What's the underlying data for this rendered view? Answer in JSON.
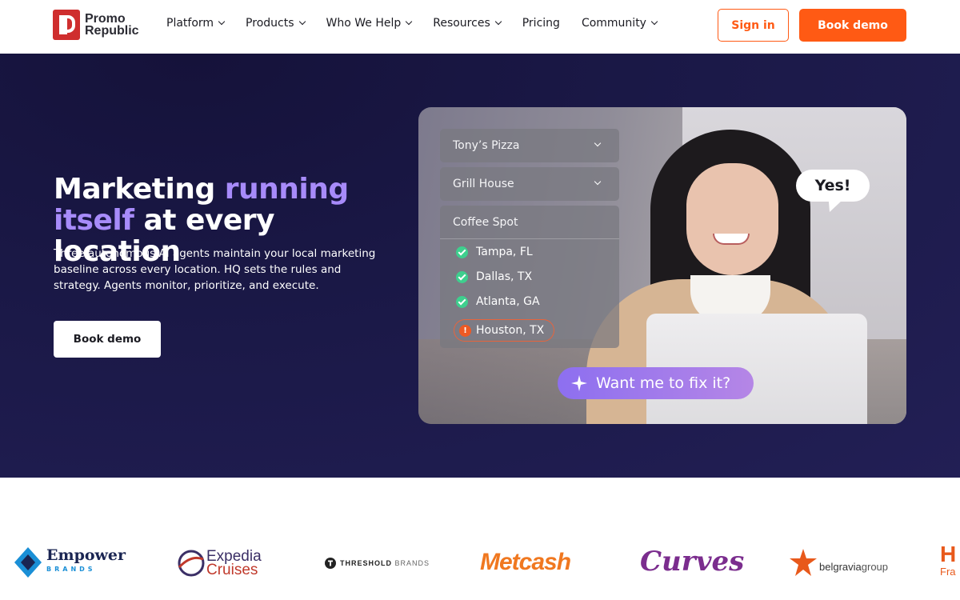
{
  "nav": {
    "logo": {
      "line1": "Promo",
      "line2": "Republic",
      "color": "#cf2e2e"
    },
    "menu": [
      {
        "label": "Platform",
        "dropdown": true
      },
      {
        "label": "Products",
        "dropdown": true
      },
      {
        "label": "Who We Help",
        "dropdown": true
      },
      {
        "label": "Resources",
        "dropdown": true
      },
      {
        "label": "Pricing",
        "dropdown": false
      },
      {
        "label": "Community",
        "dropdown": true
      }
    ],
    "sign_in": "Sign in",
    "book_demo": "Book demo",
    "accent_color": "#ff5a14"
  },
  "hero": {
    "title_part1": "Marketing ",
    "title_accent1": "running",
    "title_accent2": "itself",
    "title_part2": " at every location",
    "description": "Three autonomous AI agents maintain your local marketing baseline across every location. HQ sets the rules and strategy. Agents monitor, prioritize, and execute.",
    "cta": "Book demo",
    "bg_color": "#1a1846",
    "accent_color": "#a78bfa"
  },
  "card": {
    "dropdowns": [
      {
        "label": "Tony’s Pizza",
        "expanded": false
      },
      {
        "label": "Grill House",
        "expanded": false
      },
      {
        "label": "Coffee Spot",
        "expanded": true
      }
    ],
    "locations": [
      {
        "name": "Tampa, FL",
        "status": "ok"
      },
      {
        "name": "Dallas, TX",
        "status": "ok"
      },
      {
        "name": "Atlanta, GA",
        "status": "ok"
      }
    ],
    "alert_location": {
      "name": "Houston, TX",
      "status": "alert",
      "icon_label": "!"
    },
    "speech_bubble": "Yes!",
    "fix_prompt": "Want me to fix it?",
    "icons": {
      "ok": "check-circle-icon",
      "alert": "alert-circle-icon",
      "prompt": "sparkle-icon"
    }
  },
  "logos": {
    "empower": {
      "name": "Empower",
      "sub": "BRANDS"
    },
    "expedia": {
      "name": "Expedia",
      "sub": "Cruises"
    },
    "threshold": {
      "name": "THRESHOLD",
      "sub": "BRANDS"
    },
    "metcash": {
      "name": "Metcash"
    },
    "curves": {
      "name": "Curves"
    },
    "belgravia": {
      "name": "belgravia",
      "sub": "group"
    },
    "cut_off": {
      "letter": "H",
      "sub": "Fra"
    }
  }
}
